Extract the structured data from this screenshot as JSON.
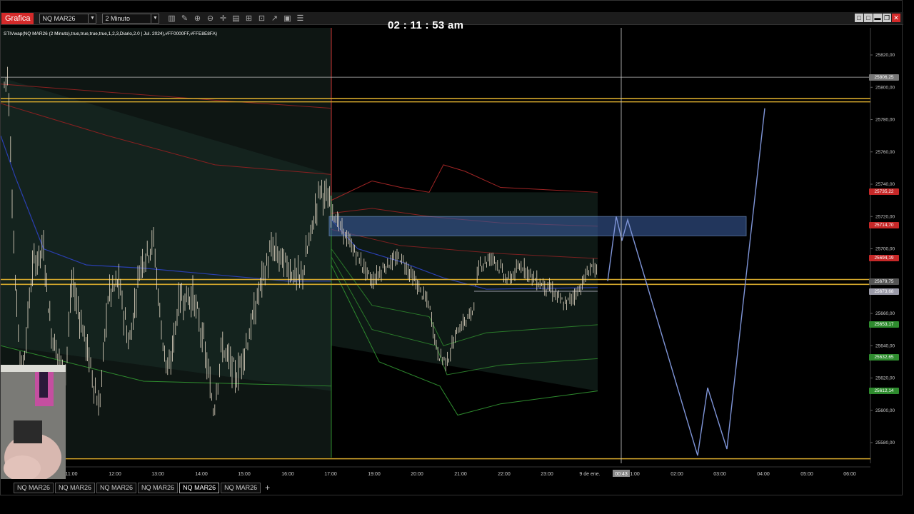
{
  "titlebar": {
    "app_label": "Grafica",
    "instrument": "NQ MAR26",
    "interval": "2 Minuto"
  },
  "toolbar_icons": [
    "bar-chart-icon",
    "pencil-icon",
    "zoom-in-icon",
    "zoom-out-icon",
    "crosshair-icon",
    "properties-icon",
    "templates-icon",
    "strategies-icon",
    "drawing-tools-icon",
    "data-box-icon",
    "list-icon"
  ],
  "window_buttons": [
    "□",
    "□",
    "▬",
    "❐",
    "✕"
  ],
  "clock": "02 : 11 : 53 am",
  "indicator_label": "STIVwap(NQ MAR26 (2 Minuto),true,true,true,true,1,2,3,Diario,2.0 | Jul. 2024),#FF0000FF,#FFE8E8FA)",
  "price_axis": {
    "min": 25570,
    "max": 25832,
    "ticks": [
      "25820,00",
      "25800,00",
      "25780,00",
      "25760,00",
      "25740,00",
      "25720,00",
      "25700,00",
      "25680,00",
      "25660,00",
      "25640,00",
      "25620,00",
      "25600,00",
      "25580,00"
    ],
    "tick_values": [
      25820,
      25800,
      25780,
      25760,
      25740,
      25720,
      25700,
      25680,
      25660,
      25640,
      25620,
      25600,
      25580
    ]
  },
  "price_tags": [
    {
      "label": "25806,25",
      "value": 25806.25,
      "color": "#777777"
    },
    {
      "label": "25735,22",
      "value": 25735.22,
      "color": "#c62828"
    },
    {
      "label": "25714,70",
      "value": 25714.7,
      "color": "#c62828"
    },
    {
      "label": "25694,19",
      "value": 25694.19,
      "color": "#c62828"
    },
    {
      "label": "25679,75",
      "value": 25679.75,
      "color": "#555555"
    },
    {
      "label": "25673,68",
      "value": 25673.68,
      "color": "#9a9aa8"
    },
    {
      "label": "25653,17",
      "value": 25653.17,
      "color": "#2e8b2e"
    },
    {
      "label": "25632,65",
      "value": 25632.65,
      "color": "#2e8b2e"
    },
    {
      "label": "25612,14",
      "value": 25612.14,
      "color": "#2e8b2e"
    }
  ],
  "time_axis": {
    "ticks": [
      "11:00",
      "12:00",
      "13:00",
      "14:00",
      "15:00",
      "16:00",
      "17:00",
      "19:00",
      "20:00",
      "21:00",
      "22:00",
      "23:00",
      "9 de ene.",
      "1:00",
      "02:00",
      "03:00",
      "04:00",
      "05:00",
      "06:00"
    ],
    "crosshair_time": "00:43"
  },
  "tabs": [
    "NQ MAR26",
    "NQ MAR26",
    "NQ MAR26",
    "NQ MAR26",
    "NQ MAR26",
    "NQ MAR26"
  ],
  "active_tab_index": 4,
  "add_tab": "+",
  "colors": {
    "background": "#000000",
    "upper_band": "#c62828",
    "lower_band": "#2e8b2e",
    "vwap": "#2a3fb0",
    "level_line": "#d4a72c",
    "zone_fill": "#3a5a9a",
    "projection": "#7f95d8",
    "candles": "#e8dcc8"
  }
}
